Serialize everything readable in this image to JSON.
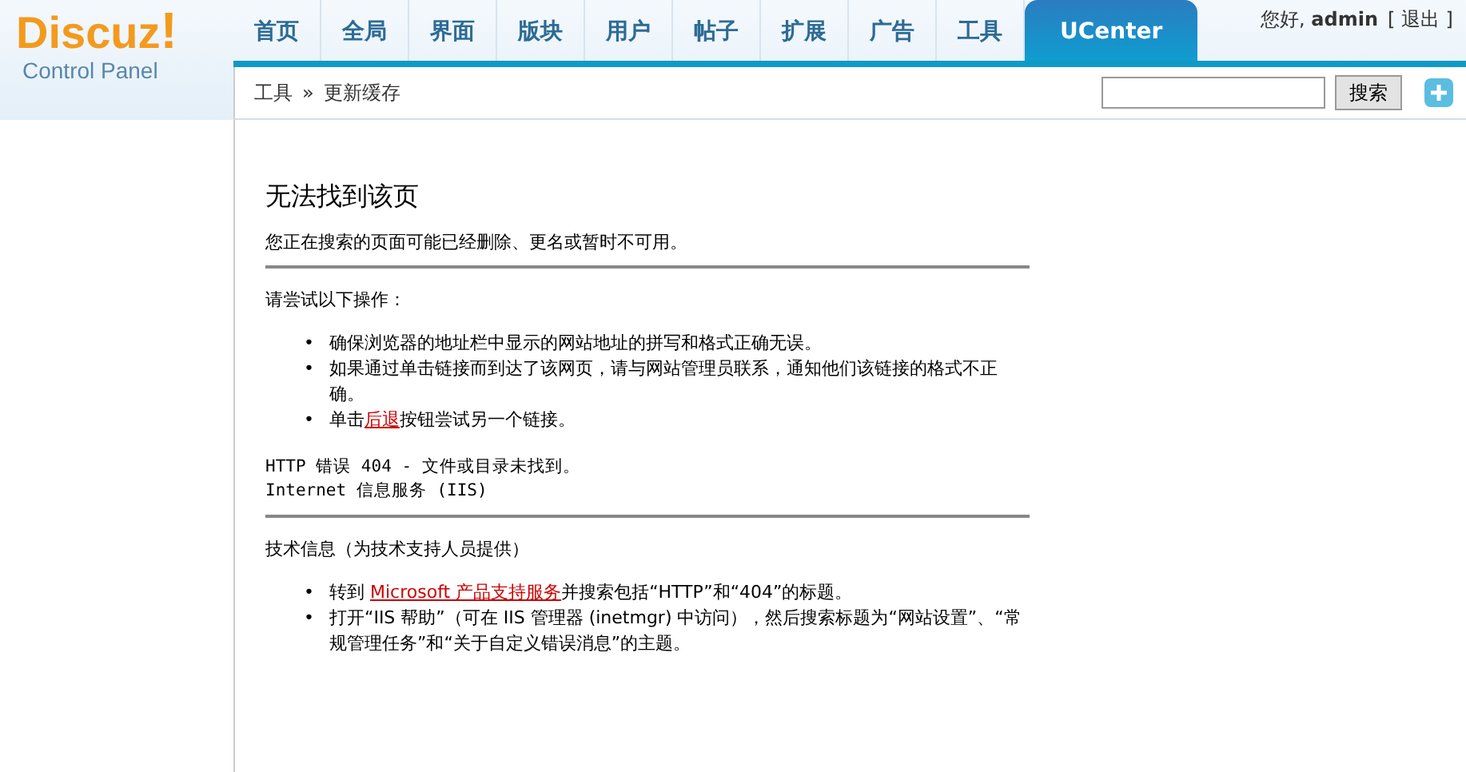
{
  "logo": {
    "title": "Discuz",
    "mark": "!",
    "subtitle": "Control Panel"
  },
  "tabs": [
    {
      "label": "首页",
      "selected": false
    },
    {
      "label": "全局",
      "selected": false
    },
    {
      "label": "界面",
      "selected": false
    },
    {
      "label": "版块",
      "selected": false
    },
    {
      "label": "用户",
      "selected": false
    },
    {
      "label": "帖子",
      "selected": false
    },
    {
      "label": "扩展",
      "selected": false
    },
    {
      "label": "广告",
      "selected": false
    },
    {
      "label": "工具",
      "selected": false
    },
    {
      "label": "UCenter",
      "selected": true
    }
  ],
  "user": {
    "greeting": "您好,",
    "name": "admin",
    "logout": "[ 退出 ]"
  },
  "breadcrumb": {
    "parent": "工具",
    "separator": "»",
    "current": "更新缓存"
  },
  "search": {
    "button": "搜索"
  },
  "error": {
    "title": "无法找到该页",
    "message": "您正在搜索的页面可能已经删除、更名或暂时不可用。",
    "try_heading": "请尝试以下操作：",
    "tips": [
      {
        "marker": "•",
        "before": "确保浏览器的地址栏中显示的网站地址的拼写和格式正确无误。"
      },
      {
        "marker": "•",
        "before": "如果通过单击链接而到达了该网页，请与网站管理员联系，通知他们该链接的格式不正确。"
      },
      {
        "marker": "•",
        "before": "单击",
        "link": "后退",
        "after": "按钮尝试另一个链接。"
      }
    ],
    "code_lines": [
      "HTTP 错误 404 - 文件或目录未找到。",
      "Internet 信息服务 (IIS)"
    ],
    "tech_heading": "技术信息（为技术支持人员提供）",
    "tech_tips": [
      {
        "marker": "•",
        "before": "转到 ",
        "link": "Microsoft 产品支持服务",
        "after": "并搜索包括“HTTP”和“404”的标题。"
      },
      {
        "marker": "•",
        "before": "打开“IIS 帮助”（可在 IIS 管理器 (inetmgr) 中访问），然后搜索标题为“网站设置”、“常规管理任务”和“关于自定义错误消息”的主题。"
      }
    ]
  }
}
